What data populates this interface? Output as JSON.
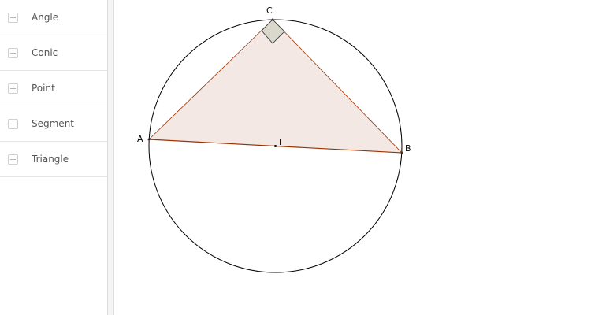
{
  "sidebar": {
    "items": [
      {
        "label": "Angle"
      },
      {
        "label": "Conic"
      },
      {
        "label": "Point"
      },
      {
        "label": "Segment"
      },
      {
        "label": "Triangle"
      }
    ]
  },
  "construction": {
    "points": {
      "A": {
        "label": "A"
      },
      "B": {
        "label": "B"
      },
      "C": {
        "label": "C"
      },
      "I": {
        "label": "I"
      }
    }
  },
  "colors": {
    "triangle_fill": "#f3e8e4",
    "triangle_stroke": "#993300",
    "right_angle_fill": "#d8d8cc",
    "circle_stroke": "#000000"
  }
}
